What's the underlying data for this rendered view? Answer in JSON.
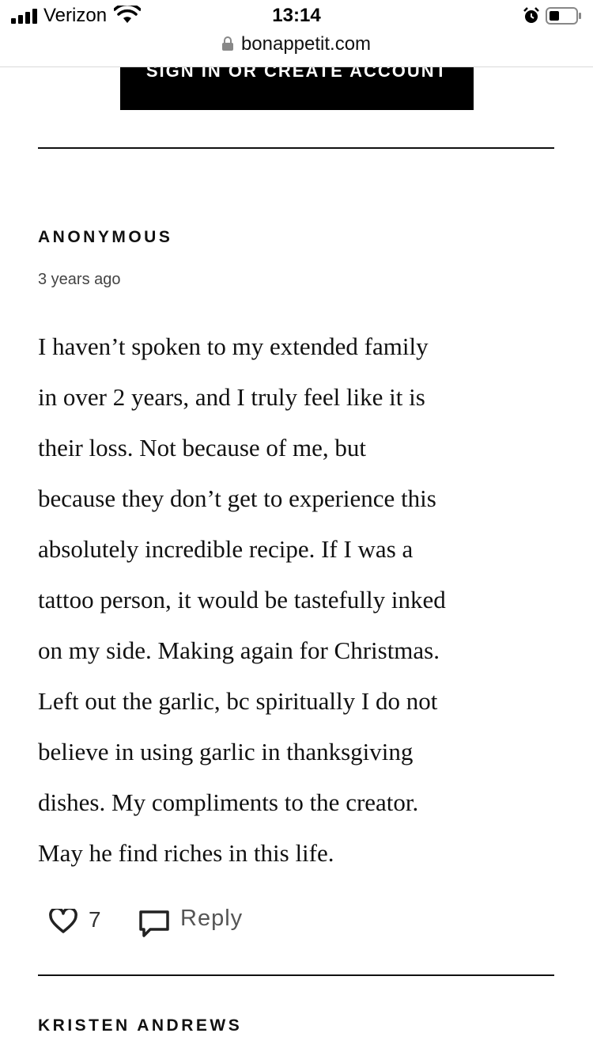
{
  "status_bar": {
    "carrier": "Verizon",
    "time": "13:14",
    "icons": [
      "signal-icon",
      "wifi-icon",
      "alarm-icon",
      "battery-icon"
    ]
  },
  "browser": {
    "url": "bonappetit.com",
    "lock_icon": "lock-icon"
  },
  "signin": {
    "label": "SIGN IN OR CREATE ACCOUNT"
  },
  "comment": {
    "author": "ANONYMOUS",
    "timestamp": "3 years ago",
    "body_lines": [
      "I haven’t spoken to my extended family",
      "in over 2 years, and I truly feel like it is",
      "their loss. Not because of me, but",
      "because they don’t get to experience this",
      "absolutely incredible recipe. If I was a",
      "tattoo person, it would be tastefully inked",
      "on my side. Making again for Christmas.",
      "Left out the garlic, bc spiritually I do not",
      "believe in using garlic in thanksgiving",
      "dishes. My compliments to the creator.",
      "May he find riches in this life."
    ],
    "likes": "7",
    "reply_label": "Reply"
  },
  "next_comment": {
    "author": "KRISTEN ANDREWS"
  },
  "colors": {
    "text": "#111111",
    "button_bg": "#000000",
    "button_text": "#ffffff"
  }
}
